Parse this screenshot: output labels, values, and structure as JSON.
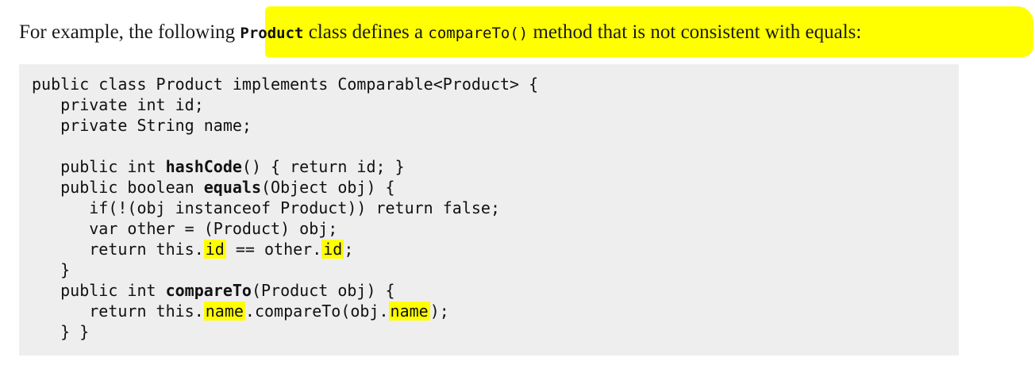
{
  "intro": {
    "before": "For example, the following ",
    "class_name": "Product",
    "middle": " class defines a ",
    "method_name": "compareTo()",
    "after": " method that is not consistent with equals:"
  },
  "code": {
    "l1": "public class Product implements Comparable<Product> {",
    "l2": "   private int id;",
    "l3": "   private String name;",
    "l4": "",
    "l5_a": "   public int ",
    "l5_kw": "hashCode",
    "l5_b": "() { return id; }",
    "l6_a": "   public boolean ",
    "l6_kw": "equals",
    "l6_b": "(Object obj) {",
    "l7": "      if(!(obj instanceof Product)) return false;",
    "l8": "      var other = (Product) obj;",
    "l9_a": "      return this.",
    "l9_h1": "id",
    "l9_b": " == other.",
    "l9_h2": "id",
    "l9_c": ";",
    "l10": "   }",
    "l11_a": "   public int ",
    "l11_kw": "compareTo",
    "l11_b": "(Product obj) {",
    "l12_a": "      return this.",
    "l12_h1": "name",
    "l12_b": ".compareTo(obj.",
    "l12_h2": "name",
    "l12_c": ");",
    "l13": "   } }"
  },
  "colors": {
    "highlight": "#ffff00",
    "code_background": "#eeeeee"
  }
}
